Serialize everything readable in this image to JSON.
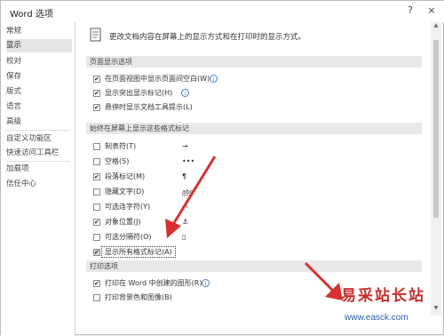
{
  "window": {
    "title": "Word 选项",
    "help_label": "?",
    "close_label": "×"
  },
  "sidebar": {
    "items": [
      {
        "label": "常规"
      },
      {
        "label": "显示"
      },
      {
        "label": "校对"
      },
      {
        "label": "保存"
      },
      {
        "label": "版式"
      },
      {
        "label": "语言"
      },
      {
        "label": "高级"
      },
      {
        "label": "自定义功能区"
      },
      {
        "label": "快速访问工具栏"
      },
      {
        "label": "加载项"
      },
      {
        "label": "信任中心"
      }
    ],
    "selected": "显示"
  },
  "header": {
    "text": "更改文档内容在屏幕上的显示方式和在打印时的显示方式。"
  },
  "sections": {
    "page_display": {
      "title": "页面显示选项",
      "options": [
        {
          "label": "在页面视图中显示页面间空白(W)",
          "checked": true,
          "info": true
        },
        {
          "label": "显示突出显示标记(H)",
          "checked": true,
          "info": true
        },
        {
          "label": "悬停时显示文档工具提示(L)",
          "checked": true,
          "info": false
        }
      ]
    },
    "formatting_marks": {
      "title": "始终在屏幕上显示这些格式标记",
      "options": [
        {
          "label": "制表符(T)",
          "checked": false,
          "symbol": "→"
        },
        {
          "label": "空格(S)",
          "checked": false,
          "symbol": "•••"
        },
        {
          "label": "段落标记(M)",
          "checked": true,
          "symbol": "¶"
        },
        {
          "label": "隐藏文字(D)",
          "checked": false,
          "symbol": "abc"
        },
        {
          "label": "可选连字符(Y)",
          "checked": false,
          "symbol": "¬"
        },
        {
          "label": "对象位置(J)",
          "checked": true,
          "symbol": "⚓"
        },
        {
          "label": "可选分隔符(O)",
          "checked": false,
          "symbol": "▯"
        },
        {
          "label": "显示所有格式标记(A)",
          "checked": true,
          "symbol": ""
        }
      ]
    },
    "print": {
      "title": "打印选项",
      "options": [
        {
          "label": "打印在 Word 中创建的图形(R)",
          "checked": true,
          "info": true
        },
        {
          "label": "打印背景色和图像(B)",
          "checked": false,
          "info": false
        }
      ]
    }
  },
  "watermark": {
    "text": "易采站长站",
    "url": "www.easck.com"
  },
  "colors": {
    "accent_red": "#d93030",
    "watermark_red": "#c62d2d",
    "watermark_blue": "#2a5ea8"
  }
}
